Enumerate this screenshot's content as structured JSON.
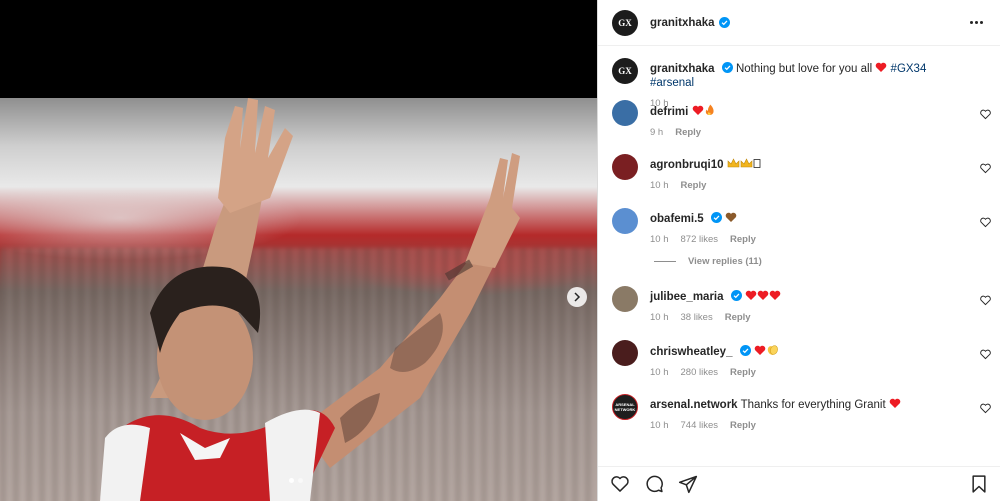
{
  "post": {
    "author": "granitxhaka",
    "avatar_text": "GX"
  },
  "caption": {
    "author": "granitxhaka",
    "text": "Nothing but love for you all",
    "hashtags": [
      "#GX34",
      "#arsenal"
    ],
    "time": "10 h"
  },
  "comments": [
    {
      "user": "defrimi",
      "verified": false,
      "text": "",
      "emojis": [
        "red-heart",
        "fire"
      ],
      "time": "9 h",
      "likes": "",
      "reply": "Reply",
      "avatar_color": "#3a6ea5"
    },
    {
      "user": "agronbruqi10",
      "verified": false,
      "text": "",
      "emojis": [
        "crown",
        "crown",
        "box"
      ],
      "time": "10 h",
      "likes": "",
      "reply": "Reply",
      "avatar_color": "#7a1f22"
    },
    {
      "user": "obafemi.5",
      "verified": true,
      "text": "",
      "emojis": [
        "brown-heart"
      ],
      "time": "10 h",
      "likes": "872 likes",
      "reply": "Reply",
      "avatar_color": "#5b8fd1"
    },
    {
      "user": "julibee_maria",
      "verified": true,
      "text": "",
      "emojis": [
        "red-heart",
        "red-heart",
        "red-heart"
      ],
      "time": "10 h",
      "likes": "38 likes",
      "reply": "Reply",
      "avatar_color": "#8a7a66"
    },
    {
      "user": "chriswheatley_",
      "verified": true,
      "text": "",
      "emojis": [
        "red-heart",
        "clap"
      ],
      "time": "10 h",
      "likes": "280 likes",
      "reply": "Reply",
      "avatar_color": "#4a1d1d"
    },
    {
      "user": "arsenal.network",
      "verified": false,
      "text": "Thanks for everything Granit",
      "emojis": [
        "red-heart"
      ],
      "time": "10 h",
      "likes": "744 likes",
      "reply": "Reply",
      "avatar_color": "#1e1e1e",
      "avatar_text": "ARSENAL NETWORK"
    }
  ],
  "view_replies": "View replies (11)",
  "colors": {
    "verified": "#0095f6",
    "heart": "#ed1c24",
    "meta": "#8e8e8e",
    "hashtag": "#00376b"
  },
  "icons": [
    "more-icon",
    "verified-icon",
    "like-icon",
    "comment-icon",
    "share-icon",
    "save-icon",
    "chevron-right-icon"
  ]
}
